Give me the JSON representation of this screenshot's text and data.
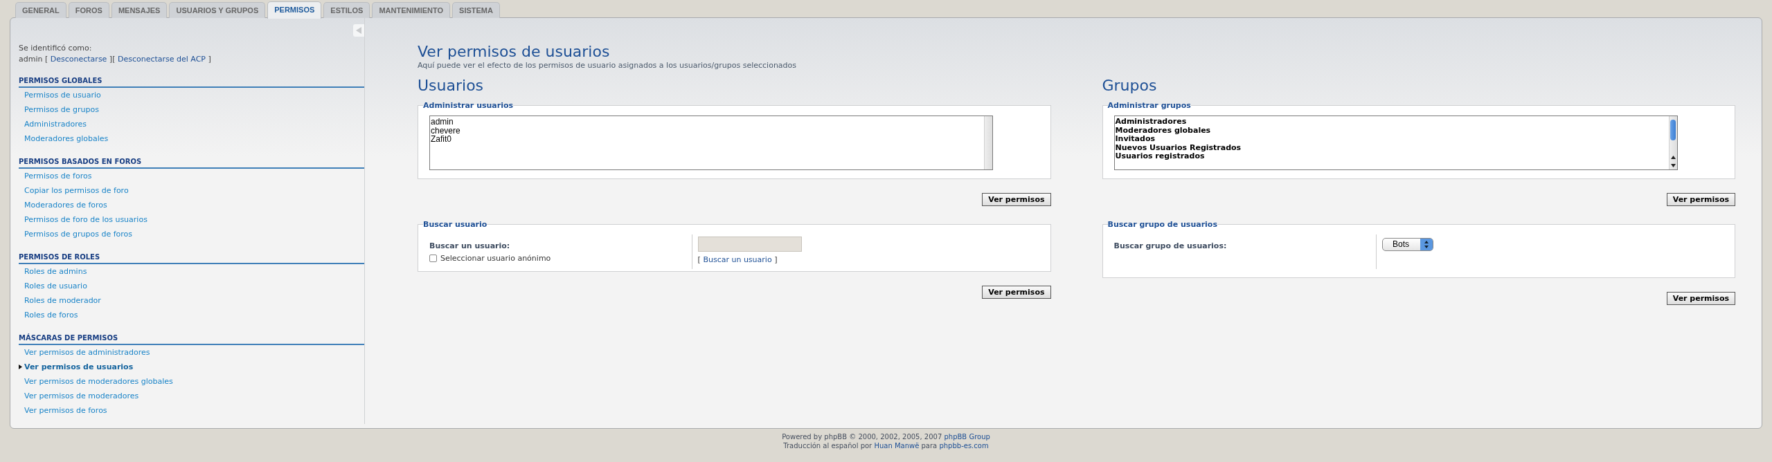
{
  "tabs": [
    {
      "label": "GENERAL",
      "selected": false
    },
    {
      "label": "FOROS",
      "selected": false
    },
    {
      "label": "MENSAJES",
      "selected": false
    },
    {
      "label": "USUARIOS Y GRUPOS",
      "selected": false
    },
    {
      "label": "PERMISOS",
      "selected": true
    },
    {
      "label": "ESTILOS",
      "selected": false
    },
    {
      "label": "MANTENIMIENTO",
      "selected": false
    },
    {
      "label": "SISTEMA",
      "selected": false
    }
  ],
  "sidebar": {
    "login_label": "Se identificó como:",
    "login_line": [
      {
        "text": "admin [ ",
        "link": false
      },
      {
        "text": "Desconectarse",
        "link": true
      },
      {
        "text": " ][ ",
        "link": false
      },
      {
        "text": "Desconectarse del ACP",
        "link": true
      },
      {
        "text": " ]",
        "link": false
      }
    ],
    "sections": [
      {
        "title": "PERMISOS GLOBALES",
        "items": [
          {
            "label": "Permisos de usuario",
            "selected": false
          },
          {
            "label": "Permisos de grupos",
            "selected": false
          },
          {
            "label": "Administradores",
            "selected": false
          },
          {
            "label": "Moderadores globales",
            "selected": false
          }
        ]
      },
      {
        "title": "PERMISOS BASADOS EN FOROS",
        "items": [
          {
            "label": "Permisos de foros",
            "selected": false
          },
          {
            "label": "Copiar los permisos de foro",
            "selected": false
          },
          {
            "label": "Moderadores de foros",
            "selected": false
          },
          {
            "label": "Permisos de foro de los usuarios",
            "selected": false
          },
          {
            "label": "Permisos de grupos de foros",
            "selected": false
          }
        ]
      },
      {
        "title": "PERMISOS DE ROLES",
        "items": [
          {
            "label": "Roles de admins",
            "selected": false
          },
          {
            "label": "Roles de usuario",
            "selected": false
          },
          {
            "label": "Roles de moderador",
            "selected": false
          },
          {
            "label": "Roles de foros",
            "selected": false
          }
        ]
      },
      {
        "title": "MÁSCARAS DE PERMISOS",
        "items": [
          {
            "label": "Ver permisos de administradores",
            "selected": false
          },
          {
            "label": "Ver permisos de usuarios",
            "selected": true
          },
          {
            "label": "Ver permisos de moderadores globales",
            "selected": false
          },
          {
            "label": "Ver permisos de moderadores",
            "selected": false
          },
          {
            "label": "Ver permisos de foros",
            "selected": false
          }
        ]
      }
    ]
  },
  "main": {
    "title": "Ver permisos de usuarios",
    "subtitle": "Aquí puede ver el efecto de los permisos de usuario asignados a los usuarios/grupos seleccionados",
    "columns": [
      {
        "heading": "Usuarios",
        "manage": {
          "legend": "Administrar usuarios",
          "bold_options": false,
          "scrollable": false,
          "options": [
            "admin",
            "chevere",
            "Zafit0"
          ]
        },
        "button": "Ver permisos",
        "search": {
          "legend": "Buscar usuario",
          "label": "Buscar un usuario:",
          "kind": "text",
          "link_before": "[ ",
          "link": "Buscar un usuario",
          "link_after": " ]",
          "checkbox": {
            "label": "Seleccionar usuario anónimo",
            "checked": false
          }
        },
        "search_button": "Ver permisos"
      },
      {
        "heading": "Grupos",
        "manage": {
          "legend": "Administrar grupos",
          "bold_options": true,
          "scrollable": true,
          "options": [
            "Administradores",
            "Moderadores globales",
            "Invitados",
            "Nuevos Usuarios Registrados",
            "Usuarios registrados"
          ]
        },
        "button": "Ver permisos",
        "search": {
          "legend": "Buscar grupo de usuarios",
          "label": "Buscar grupo de usuarios:",
          "kind": "select",
          "value": "Bots"
        },
        "search_button": "Ver permisos"
      }
    ]
  },
  "footer": [
    [
      {
        "text": "Powered by phpBB © 2000, 2002, 2005, 2007 ",
        "link": false
      },
      {
        "text": "phpBB Group",
        "link": true
      }
    ],
    [
      {
        "text": "Traducción al español por ",
        "link": false
      },
      {
        "text": "Huan Manwë",
        "link": true
      },
      {
        "text": " para ",
        "link": false
      },
      {
        "text": "phpbb-es.com",
        "link": true
      }
    ]
  ]
}
